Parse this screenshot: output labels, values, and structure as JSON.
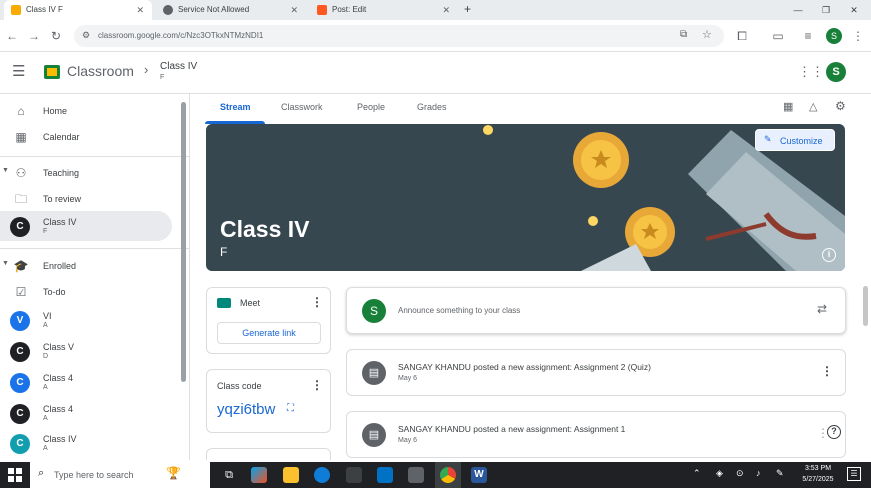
{
  "browser": {
    "tabs": [
      {
        "title": "Class IV F",
        "active": true,
        "favicon_color": "#f9ab00"
      },
      {
        "title": "Service Not Allowed",
        "active": false,
        "favicon_color": "#5f6368"
      },
      {
        "title": "Post: Edit",
        "active": false,
        "favicon_color": "#ff5722"
      }
    ],
    "new_tab": "+",
    "url": "classroom.google.com/c/Nzc3OTkxNTMzNDI1"
  },
  "app": {
    "name": "Classroom",
    "breadcrumb_title": "Class IV",
    "breadcrumb_sub": "F",
    "user_initial": "S"
  },
  "sidebar": {
    "home": "Home",
    "calendar": "Calendar",
    "teaching": "Teaching",
    "to_review": "To review",
    "teaching_class": {
      "name": "Class IV",
      "section": "F",
      "initial": "C",
      "color": "#202124"
    },
    "enrolled": "Enrolled",
    "todo": "To-do",
    "enrolled_classes": [
      {
        "name": "VI",
        "section": "A",
        "initial": "V",
        "color": "#1a73e8"
      },
      {
        "name": "Class V",
        "section": "D",
        "initial": "C",
        "color": "#202124"
      },
      {
        "name": "Class 4",
        "section": "A",
        "initial": "C",
        "color": "#1a73e8"
      },
      {
        "name": "Class 4",
        "section": "A",
        "initial": "C",
        "color": "#202124"
      },
      {
        "name": "Class IV",
        "section": "A",
        "initial": "C",
        "color": "#129eaf"
      }
    ]
  },
  "main": {
    "tabs": [
      "Stream",
      "Classwork",
      "People",
      "Grades"
    ],
    "active_tab": "Stream",
    "banner": {
      "title": "Class IV",
      "section": "F",
      "customize": "Customize",
      "bg": "#37474f"
    },
    "meet": {
      "label": "Meet",
      "button": "Generate link"
    },
    "class_code": {
      "label": "Class code",
      "code": "yqzi6tbw"
    },
    "announce_placeholder": "Announce something to your class",
    "posts": [
      {
        "text": "SANGAY KHANDU posted a new assignment: Assignment 2 (Quiz)",
        "date": "May 6"
      },
      {
        "text": "SANGAY KHANDU posted a new assignment: Assignment 1",
        "date": "May 6"
      }
    ]
  },
  "taskbar": {
    "search_placeholder": "Type here to search",
    "time": "3:53 PM",
    "date": "5/27/2025"
  }
}
